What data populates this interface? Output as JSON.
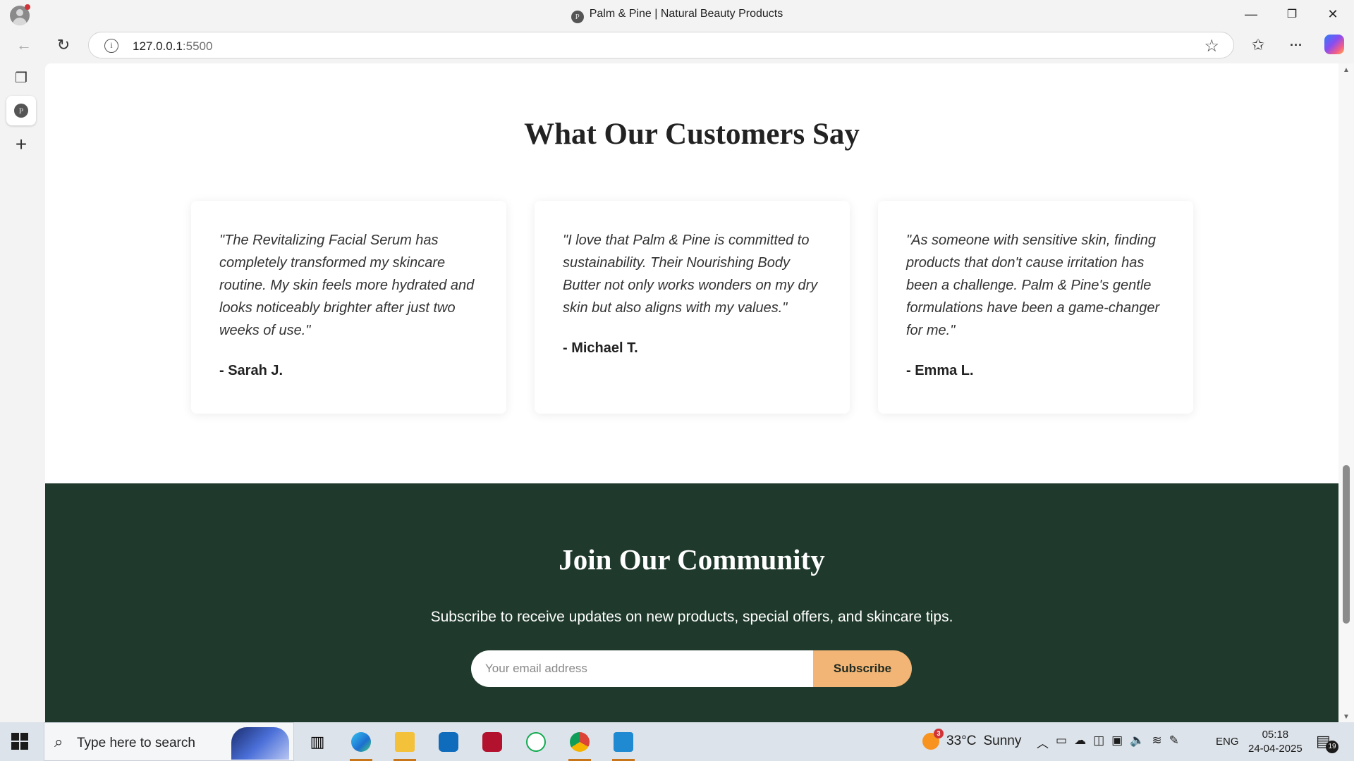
{
  "window": {
    "title": "Palm & Pine | Natural Beauty Products",
    "favicon_letter": "P",
    "minimize": "—",
    "restore": "❐",
    "close": "✕"
  },
  "navbar": {
    "url_host": "127.0.0.1",
    "url_port": ":5500",
    "back_icon": "←",
    "refresh_icon": "↻",
    "info_icon": "i",
    "favorite_icon": "☆",
    "favorites_icon": "✩",
    "more_icon": "···"
  },
  "sidebar": {
    "tabs_icon": "❐",
    "tab_letter": "P",
    "new_tab_icon": "+"
  },
  "testimonials": {
    "title": "What Our Customers Say",
    "items": [
      {
        "quote": "\"The Revitalizing Facial Serum has completely transformed my skincare routine. My skin feels more hydrated and looks noticeably brighter after just two weeks of use.\"",
        "author": "- Sarah J."
      },
      {
        "quote": "\"I love that Palm & Pine is committed to sustainability. Their Nourishing Body Butter not only works wonders on my dry skin but also aligns with my values.\"",
        "author": "- Michael T."
      },
      {
        "quote": "\"As someone with sensitive skin, finding products that don't cause irritation has been a challenge. Palm & Pine's gentle formulations have been a game-changer for me.\"",
        "author": "- Emma L."
      }
    ]
  },
  "community": {
    "title": "Join Our Community",
    "text": "Subscribe to receive updates on new products, special offers, and skincare tips.",
    "email_placeholder": "Your email address",
    "button": "Subscribe"
  },
  "taskbar": {
    "search_placeholder": "Type here to search",
    "weather_temp": "33°C",
    "weather_desc": "Sunny",
    "weather_badge": "3",
    "language": "ENG",
    "time": "05:18",
    "date": "24-04-2025",
    "notifications": "19",
    "apps": [
      "task-view",
      "edge",
      "file-explorer",
      "outlook",
      "recorder",
      "mongodb",
      "chrome",
      "vscode"
    ]
  },
  "colors": {
    "community_bg": "#1f3a2c",
    "subscribe_button": "#f2b575"
  }
}
